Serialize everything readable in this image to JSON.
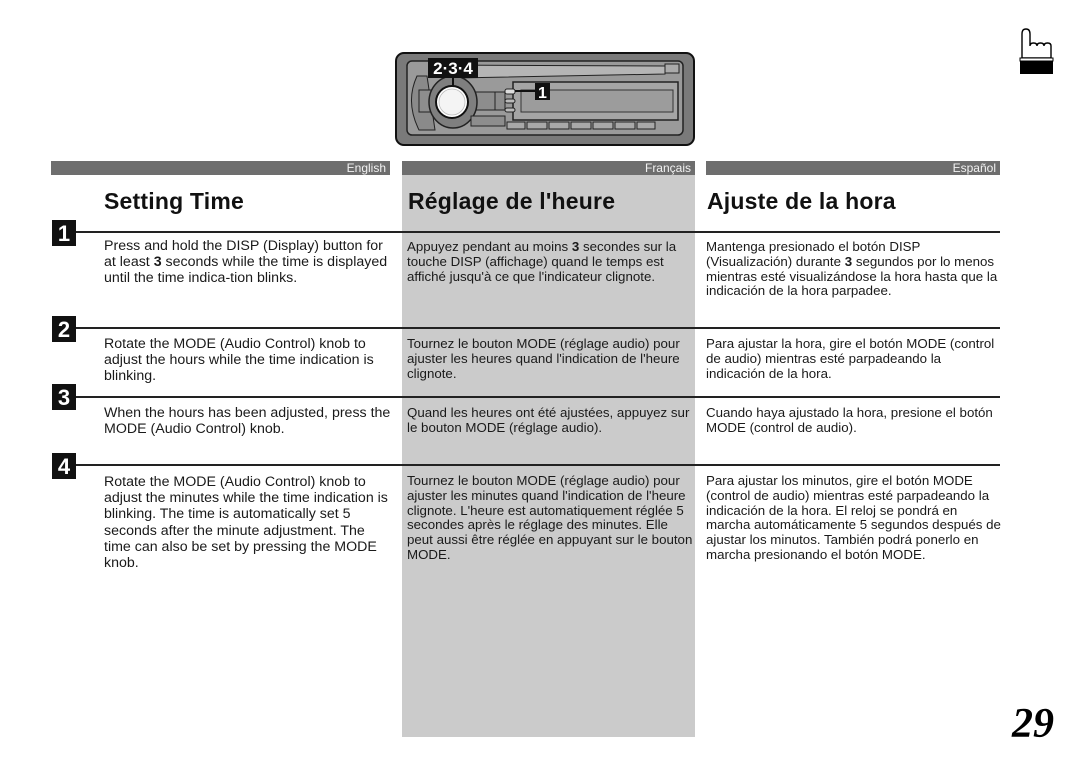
{
  "illustration": {
    "callout_knob": "2·3·4",
    "callout_disp": "1"
  },
  "icons": {
    "pointing_hand": "pointing-hand-icon"
  },
  "languages": {
    "english": "English",
    "french": "Français",
    "spanish": "Español"
  },
  "titles": {
    "english": "Setting Time",
    "french": "Réglage de l'heure",
    "spanish": "Ajuste de la hora"
  },
  "steps": [
    {
      "number": "1",
      "english": [
        "Press and hold the DISP (Display) button for at least ",
        "3",
        " seconds while the time is displayed until the time indica-tion blinks."
      ],
      "french": [
        "Appuyez pendant au moins ",
        "3",
        " secondes sur la touche DISP (affichage) quand le temps est affiché jusqu'à ce que l'indicateur clignote."
      ],
      "spanish": [
        "Mantenga presionado el botón DISP (Visualización) durante ",
        "3",
        " segundos por lo menos mientras esté visualizándose la hora hasta que la indicación de la hora parpadee."
      ]
    },
    {
      "number": "2",
      "english": "Rotate the MODE (Audio Control) knob to adjust the hours while the time indication is blinking.",
      "french": "Tournez le bouton MODE (réglage audio) pour ajuster les heures quand l'indication de l'heure clignote.",
      "spanish": "Para ajustar la hora, gire el botón MODE (control de audio) mientras esté parpadeando la indicación de la hora."
    },
    {
      "number": "3",
      "english": "When the hours has been adjusted, press the MODE (Audio Control) knob.",
      "french": "Quand les heures ont été ajustées, appuyez sur le bouton MODE (réglage audio).",
      "spanish": "Cuando haya ajustado la hora, presione el botón MODE (control de audio)."
    },
    {
      "number": "4",
      "english": "Rotate the MODE (Audio Control) knob to adjust the minutes while the time indication is blinking. The time is automatically set 5 seconds after the minute adjustment. The time can also be set by pressing the MODE knob.",
      "french": "Tournez le bouton MODE (réglage audio) pour ajuster les minutes quand l'indication de l'heure clignote. L'heure est automatiquement réglée 5 secondes après le réglage des minutes. Elle peut aussi être réglée en appuyant sur le bouton MODE.",
      "spanish": "Para ajustar los minutos, gire el botón MODE (control de audio) mientras esté parpadeando la indicación de la hora. El reloj se pondrá en marcha automáticamente 5 segundos después de ajustar los minutos. También podrá ponerlo en marcha presionando el botón MODE."
    }
  ],
  "page_number": "29",
  "colors": {
    "language_bar": "#6e6e6e",
    "french_column": "#cbcbcb",
    "step_badge": "#111111"
  }
}
